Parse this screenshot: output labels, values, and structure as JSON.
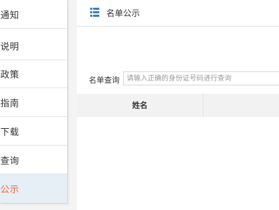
{
  "sidebar": {
    "items": [
      {
        "label": "要通知",
        "active": false
      },
      {
        "label": "程说明",
        "active": false
      },
      {
        "label": "关政策",
        "active": false
      },
      {
        "label": "理指南",
        "active": false
      },
      {
        "label": "料下载",
        "active": false
      },
      {
        "label": "分查询",
        "active": false
      },
      {
        "label": "单公示",
        "active": true
      }
    ]
  },
  "main": {
    "icon": "list-icon",
    "title": "名单公示",
    "search": {
      "label": "名单查询",
      "placeholder": "请输入正确的身份证号码进行查询",
      "value": ""
    },
    "table": {
      "columns": [
        "姓名"
      ]
    }
  },
  "colors": {
    "active_text": "#e8663d",
    "active_bg": "#e6eef6",
    "icon": "#3a7fc1"
  }
}
